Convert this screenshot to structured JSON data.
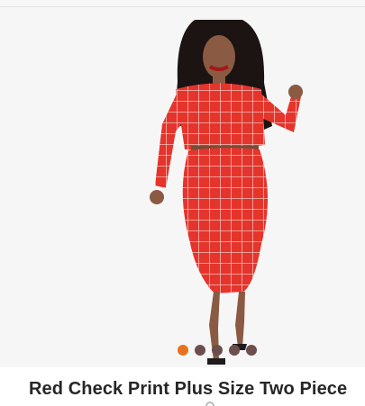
{
  "product": {
    "title": "Red Check Print Plus Size Two Piece"
  },
  "gallery": {
    "image_icon": "model-in-red-check-print-dress-image",
    "dots": [
      {
        "color": "#e8731e",
        "active": true
      },
      {
        "color": "#6b4f4c",
        "active": false
      },
      {
        "color": "#6b4f4c",
        "active": false
      },
      {
        "color": "#6b4f4c",
        "active": false
      },
      {
        "color": "#6b4f4c",
        "active": false
      }
    ]
  },
  "colors": {
    "dress": "#e5342b",
    "grid": "#f3d6cf",
    "skin": "#8a5a42",
    "hair": "#1b1413",
    "background": "#f6f6f6"
  }
}
